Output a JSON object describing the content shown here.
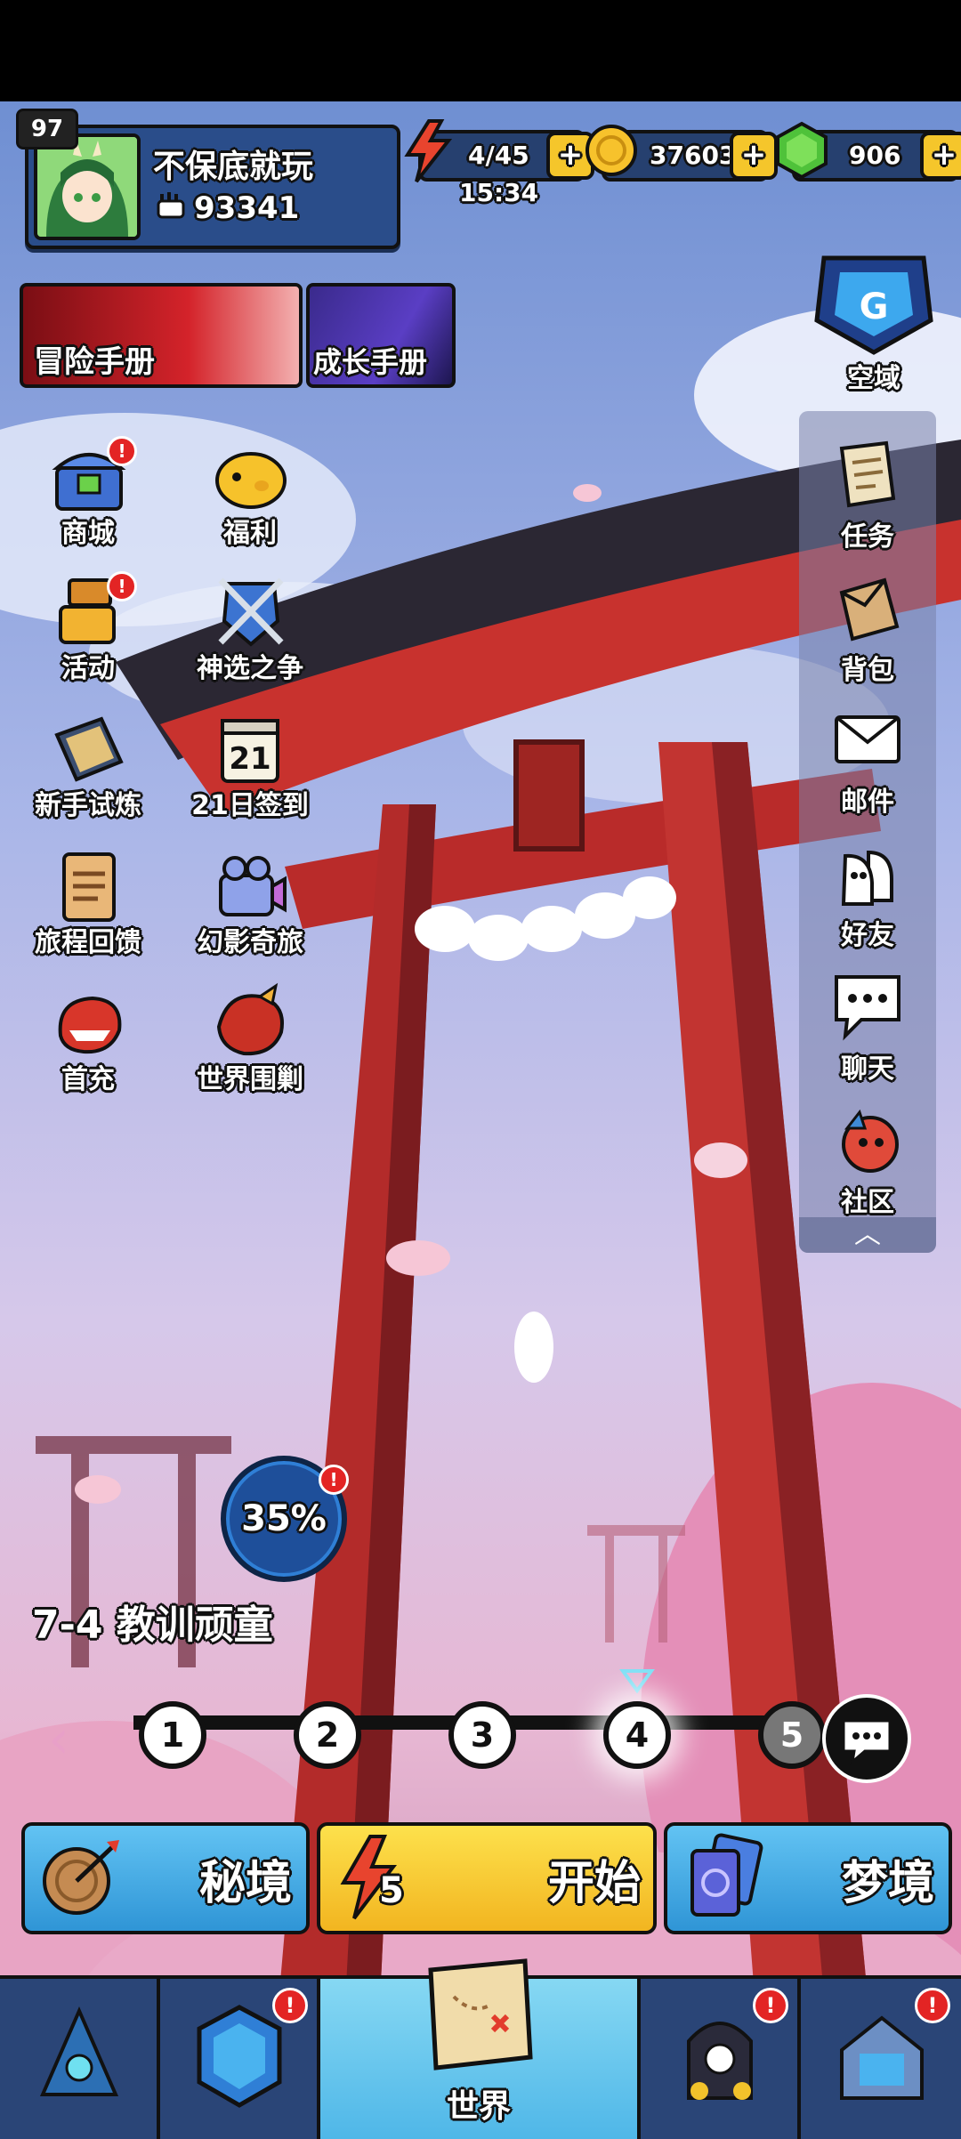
{
  "player": {
    "level": "97",
    "name": "不保底就玩",
    "power": "93341"
  },
  "resources": {
    "energy": "4/45",
    "energy_timer": "15:34",
    "gold": "37603",
    "gems": "906",
    "plus_symbol": "+"
  },
  "banners": [
    {
      "label": "冒险手册"
    },
    {
      "label": "成长手册"
    }
  ],
  "airspace": {
    "label": "空域"
  },
  "left_menu": [
    {
      "label": "商城",
      "badge": "!"
    },
    {
      "label": "福利"
    },
    {
      "label": "活动",
      "badge": "!"
    },
    {
      "label": "神选之争"
    },
    {
      "label": "新手试炼"
    },
    {
      "label": "21日签到",
      "icon_text": "21"
    },
    {
      "label": "旅程回馈"
    },
    {
      "label": "幻影奇旅"
    },
    {
      "label": "首充"
    },
    {
      "label": "世界围剿"
    }
  ],
  "right_menu": [
    {
      "label": "任务"
    },
    {
      "label": "背包"
    },
    {
      "label": "邮件"
    },
    {
      "label": "好友"
    },
    {
      "label": "聊天"
    },
    {
      "label": "社区"
    }
  ],
  "collapse_symbol": "︿",
  "progress": {
    "percent_text": "35%",
    "value": 0.35,
    "badge": "!"
  },
  "stage": {
    "title": "7-4 教训顽童",
    "nodes": [
      "1",
      "2",
      "3",
      "4",
      "5"
    ],
    "current": 4,
    "arrow_left": "‹"
  },
  "actions": {
    "secret": "秘境",
    "start": "开始",
    "start_cost": "5",
    "dream": "梦境"
  },
  "bottom_nav": {
    "world": "世界",
    "badge": "!"
  },
  "colors": {
    "gate_red": "#c8322e",
    "start_yellow": "#f6c82c",
    "action_blue": "#3fa8e4",
    "nav_active": "#6ccbf0"
  }
}
